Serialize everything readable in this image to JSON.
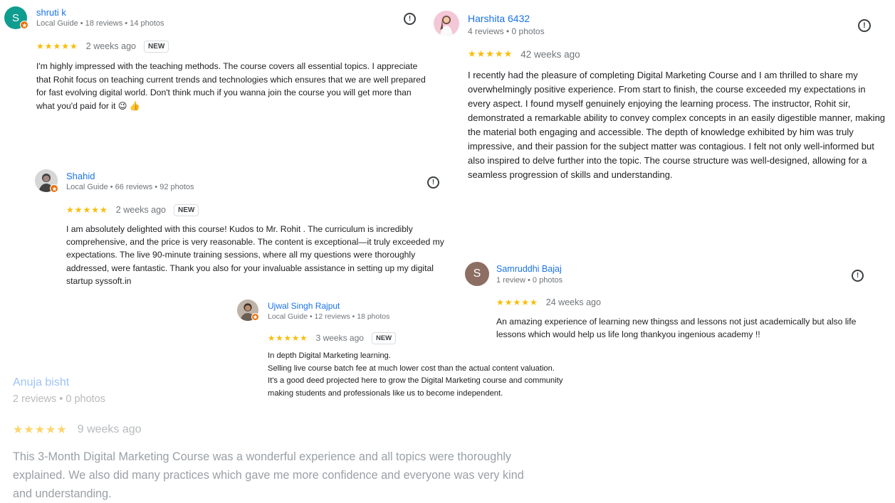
{
  "reviews": [
    {
      "id": "shruti",
      "avatar_letter": "S",
      "avatar_color": "#0f9d8f",
      "name": "shruti k",
      "meta": "Local Guide • 18 reviews • 14 photos",
      "stars": "★★★★★",
      "rating": 5,
      "ago": "2 weeks ago",
      "new_label": "NEW",
      "text": "I'm highly impressed with the teaching methods. The course covers all essential topics. I appreciate that Rohit focus on teaching current trends and technologies which ensures that we are well prepared for fast evolving digital world. Don't think much if you wanna join the course you will get more than what you'd paid for it 😉 👍"
    },
    {
      "id": "harshita",
      "name": "Harshita 6432",
      "meta": "4 reviews • 0 photos",
      "stars": "★★★★★",
      "rating": 5,
      "ago": "42 weeks ago",
      "text": "I recently had the pleasure of completing Digital Marketing Course and I am thrilled to share my overwhelmingly positive experience. From start to finish, the course exceeded my expectations in every aspect. I found myself genuinely enjoying the learning process. The instructor, Rohit sir, demonstrated a remarkable ability to convey complex concepts in an easily digestible manner, making the material both engaging and accessible. The depth of knowledge exhibited by him was truly impressive, and their passion for the subject matter was contagious. I felt not only well-informed but also inspired to delve further into the topic. The course structure was well-designed, allowing for a seamless progression of skills and understanding."
    },
    {
      "id": "shahid",
      "name": "Shahid",
      "meta": "Local Guide • 66 reviews • 92 photos",
      "stars": "★★★★★",
      "rating": 5,
      "ago": "2 weeks ago",
      "new_label": "NEW",
      "text": "I am absolutely delighted with this course! Kudos to Mr. Rohit . The curriculum is incredibly comprehensive, and the price is very reasonable. The content is exceptional—it truly exceeded my expectations. The live 90-minute training sessions, where all my questions were thoroughly addressed, were fantastic. Thank you also for your invaluable assistance in setting up my digital startup syssoft.in"
    },
    {
      "id": "samruddhi",
      "avatar_letter": "S",
      "avatar_color": "#8d6e63",
      "name": "Samruddhi Bajaj",
      "meta": "1 review • 0 photos",
      "stars": "★★★★★",
      "rating": 5,
      "ago": "24 weeks ago",
      "text": "An amazing experience of learning new thingss and lessons not just academically but also life lessons which would help us life long thankyou ingenious academy !!"
    },
    {
      "id": "ujwal",
      "name": "Ujwal Singh Rajput",
      "meta": "Local Guide • 12 reviews • 18 photos",
      "stars": "★★★★★",
      "rating": 5,
      "ago": "3 weeks ago",
      "new_label": "NEW",
      "text_lines": [
        "In depth Digital Marketing learning.",
        "Selling live course batch fee at much lower cost than the actual content valuation.",
        "It's a good deed projected here to grow the Digital Marketing course and community",
        "making students and professionals like us to become independent."
      ]
    },
    {
      "id": "anuja",
      "name": "Anuja bisht",
      "meta": "2 reviews • 0 photos",
      "stars": "★★★★★",
      "rating": 5,
      "ago": "9 weeks ago",
      "text": "This 3-Month Digital Marketing Course was a wonderful experience and all topics were thoroughly explained. We also did many practices which gave me more confidence and everyone was very kind and understanding."
    }
  ],
  "colors": {
    "name_link": "#1a73e8",
    "star": "#fbbc04",
    "meta": "#70757a",
    "local_guide_badge": "#e8710a"
  },
  "icons": {
    "flag": "report-icon",
    "guide": "local-guide-star-icon"
  }
}
